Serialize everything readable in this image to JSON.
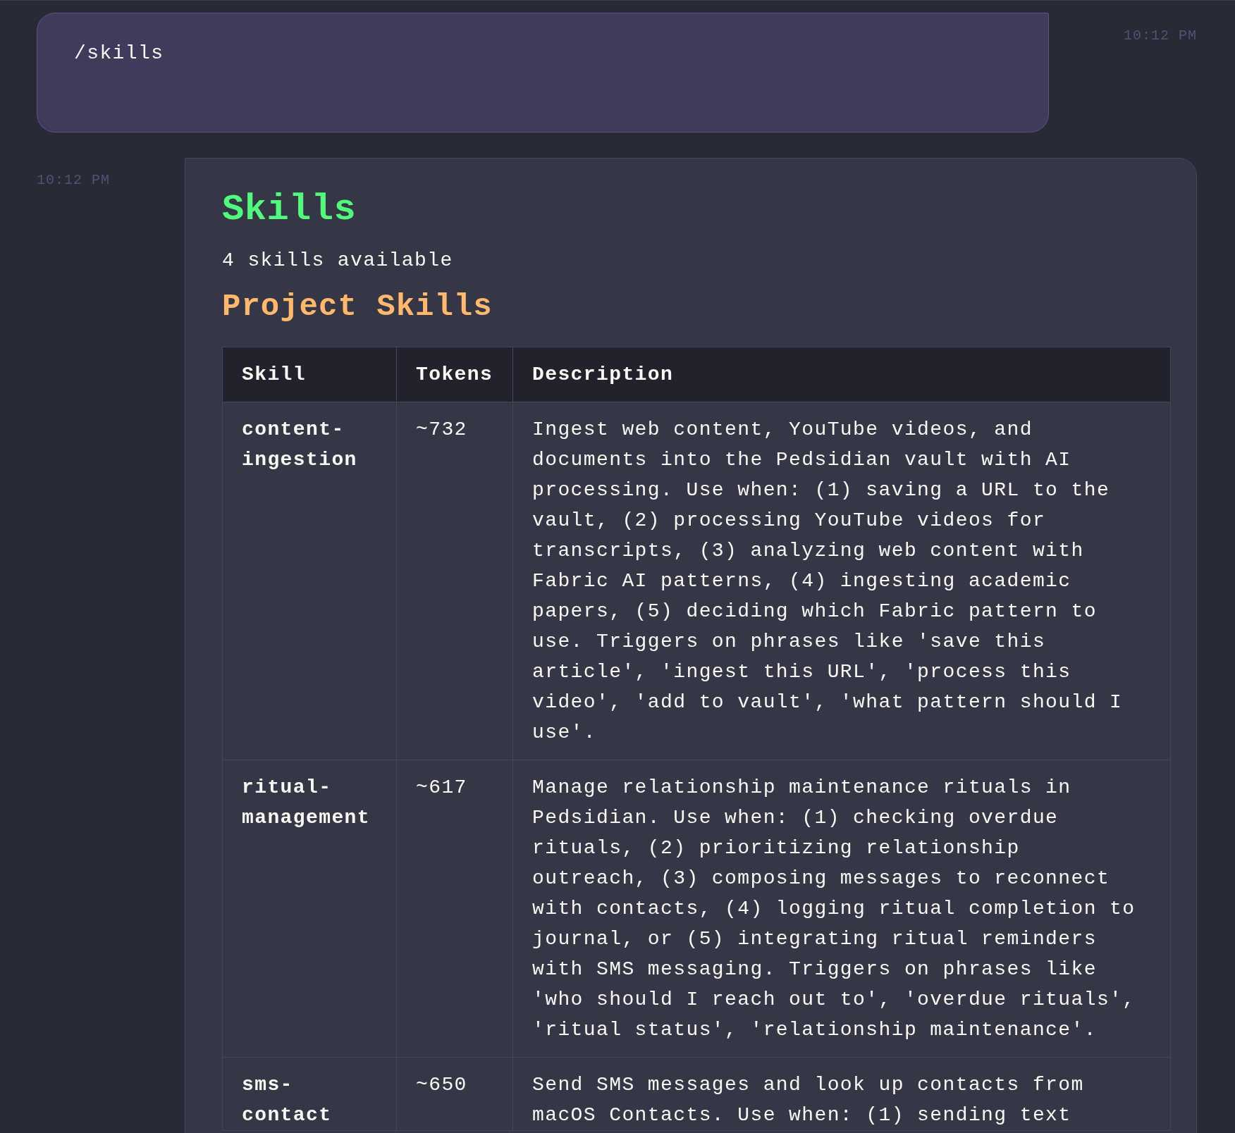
{
  "user_message": {
    "text": "/skills",
    "time": "10:12 PM"
  },
  "response": {
    "time": "10:12 PM",
    "title": "Skills",
    "summary": "4 skills available",
    "section": "Project Skills",
    "table": {
      "columns": [
        "Skill",
        "Tokens",
        "Description"
      ],
      "rows": [
        {
          "skill": "content-ingestion",
          "tokens": "~732",
          "description": "Ingest web content, YouTube videos, and documents into the Pedsidian vault with AI processing. Use when: (1) saving a URL to the vault, (2) processing YouTube videos for transcripts, (3) analyzing web content with Fabric AI patterns, (4) ingesting academic papers, (5) deciding which Fabric pattern to use. Triggers on phrases like 'save this article', 'ingest this URL', 'process this video', 'add to vault', 'what pattern should I use'."
        },
        {
          "skill": "ritual-management",
          "tokens": "~617",
          "description": "Manage relationship maintenance rituals in Pedsidian. Use when: (1) checking overdue rituals, (2) prioritizing relationship outreach, (3) composing messages to reconnect with contacts, (4) logging ritual completion to journal, or (5) integrating ritual reminders with SMS messaging. Triggers on phrases like 'who should I reach out to', 'overdue rituals', 'ritual status', 'relationship maintenance'."
        },
        {
          "skill": "sms-contact",
          "tokens": "~650",
          "description": "Send SMS messages and look up contacts from macOS Contacts. Use when: (1) sending text"
        }
      ]
    }
  }
}
